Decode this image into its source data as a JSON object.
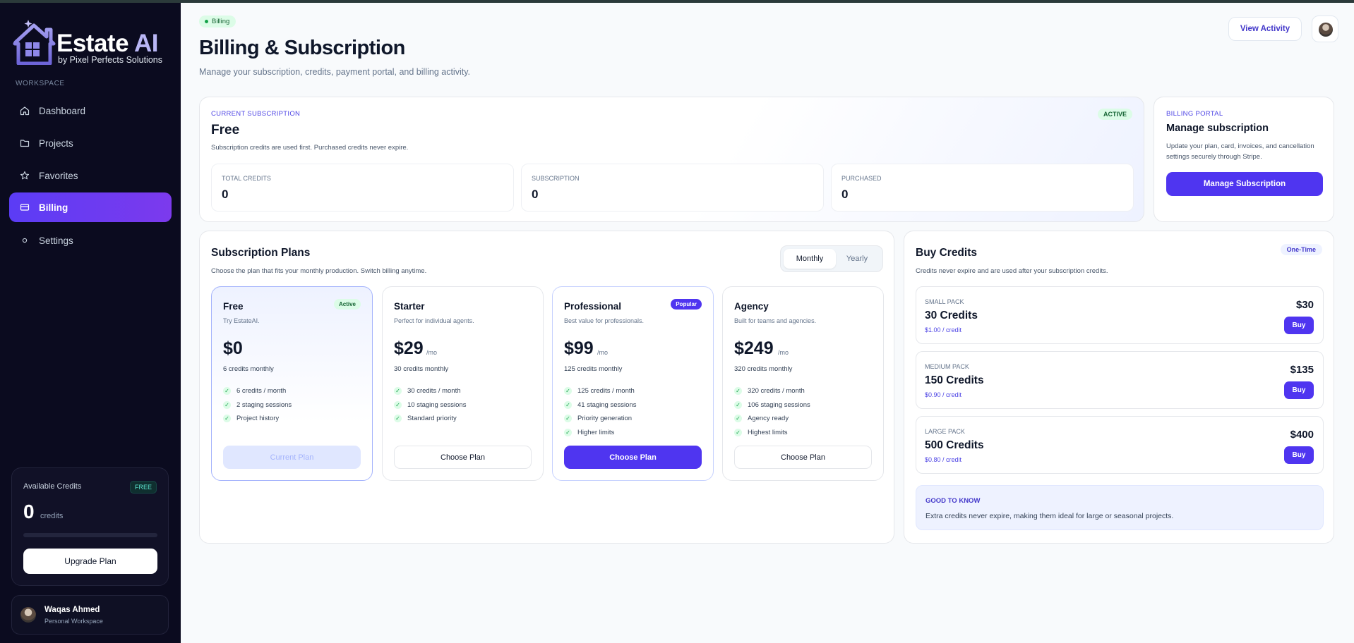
{
  "brand": {
    "title": "Estate ",
    "title_accent": "AI",
    "subtitle": "by Pixel Perfects Solutions"
  },
  "sidebar": {
    "section_label": "WORKSPACE",
    "items": [
      {
        "label": "Dashboard",
        "icon": "home-icon"
      },
      {
        "label": "Projects",
        "icon": "folder-icon"
      },
      {
        "label": "Favorites",
        "icon": "star-icon"
      },
      {
        "label": "Billing",
        "icon": "card-icon",
        "active": true
      },
      {
        "label": "Settings",
        "icon": "dot-icon"
      }
    ],
    "credits": {
      "label": "Available Credits",
      "badge": "FREE",
      "value": "0",
      "unit": "credits",
      "usage_fraction": 0,
      "button": "Upgrade Plan"
    },
    "user": {
      "name": "Waqas Ahmed",
      "workspace": "Personal Workspace"
    }
  },
  "header": {
    "pill": "Billing",
    "title": "Billing & Subscription",
    "subtitle": "Manage your subscription, credits, payment portal, and billing activity.",
    "view_activity": "View Activity"
  },
  "subscription": {
    "eyebrow": "CURRENT SUBSCRIPTION",
    "plan": "Free",
    "note": "Subscription credits are used first. Purchased credits never expire.",
    "status": "ACTIVE",
    "stats": [
      {
        "label": "TOTAL CREDITS",
        "value": "0"
      },
      {
        "label": "SUBSCRIPTION",
        "value": "0"
      },
      {
        "label": "PURCHASED",
        "value": "0"
      }
    ]
  },
  "portal": {
    "eyebrow": "BILLING PORTAL",
    "title": "Manage subscription",
    "desc": "Update your plan, card, invoices, and cancellation settings securely through Stripe.",
    "button": "Manage Subscription"
  },
  "plans": {
    "title": "Subscription Plans",
    "subtitle": "Choose the plan that fits your monthly production. Switch billing anytime.",
    "toggle": {
      "monthly": "Monthly",
      "yearly": "Yearly",
      "selected": "Monthly"
    },
    "items": [
      {
        "name": "Free",
        "desc": "Try EstateAI.",
        "price": "$0",
        "per": "",
        "credits": "6 credits monthly",
        "features": [
          "6 credits / month",
          "2 staging sessions",
          "Project history"
        ],
        "badge": "Active",
        "button": "Current Plan"
      },
      {
        "name": "Starter",
        "desc": "Perfect for individual agents.",
        "price": "$29",
        "per": "/mo",
        "credits": "30 credits monthly",
        "features": [
          "30 credits / month",
          "10 staging sessions",
          "Standard priority"
        ],
        "badge": "",
        "button": "Choose Plan"
      },
      {
        "name": "Professional",
        "desc": "Best value for professionals.",
        "price": "$99",
        "per": "/mo",
        "credits": "125 credits monthly",
        "features": [
          "125 credits / month",
          "41 staging sessions",
          "Priority generation",
          "Higher limits"
        ],
        "badge": "Popular",
        "button": "Choose Plan"
      },
      {
        "name": "Agency",
        "desc": "Built for teams and agencies.",
        "price": "$249",
        "per": "/mo",
        "credits": "320 credits monthly",
        "features": [
          "320 credits / month",
          "106 staging sessions",
          "Agency ready",
          "Highest limits"
        ],
        "badge": "",
        "button": "Choose Plan"
      }
    ]
  },
  "buy": {
    "title": "Buy Credits",
    "subtitle": "Credits never expire and are used after your subscription credits.",
    "badge": "One-Time",
    "packs": [
      {
        "label": "SMALL PACK",
        "credits": "30 Credits",
        "unit": "$1.00 / credit",
        "price": "$30",
        "button": "Buy"
      },
      {
        "label": "MEDIUM PACK",
        "credits": "150 Credits",
        "unit": "$0.90 / credit",
        "price": "$135",
        "button": "Buy"
      },
      {
        "label": "LARGE PACK",
        "credits": "500 Credits",
        "unit": "$0.80 / credit",
        "price": "$400",
        "button": "Buy"
      }
    ],
    "good_to_know": {
      "label": "GOOD TO KNOW",
      "text": "Extra credits never expire, making them ideal for large or seasonal projects."
    }
  },
  "colors": {
    "accent": "#4f35f0",
    "sidebar_bg": "#0b0b1f",
    "success": "#16a34a"
  }
}
